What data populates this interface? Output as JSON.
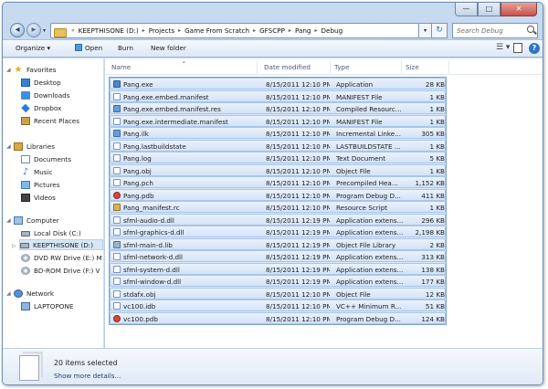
{
  "address": {
    "crumbs": [
      "KEEPTHISONE (D:)",
      "Projects",
      "Game From Scratch",
      "GFSCPP",
      "Pang",
      "Debug"
    ],
    "overflow_glyph": "«",
    "separator_glyph": "▸"
  },
  "search": {
    "placeholder": "Search Debug"
  },
  "window_controls": {
    "minimize": "—",
    "maximize": "□",
    "close": "✕"
  },
  "toolbar": {
    "organize_label": "Organize ▾",
    "open_label": "Open",
    "burn_label": "Burn",
    "new_folder_label": "New folder",
    "views_glyph": "☰ ▾",
    "help_glyph": "?"
  },
  "nav": {
    "favorites_label": "Favorites",
    "favorites": [
      "Desktop",
      "Downloads",
      "Dropbox",
      "Recent Places"
    ],
    "libraries_label": "Libraries",
    "libraries": [
      "Documents",
      "Music",
      "Pictures",
      "Videos"
    ],
    "computer_label": "Computer",
    "drives": [
      "Local Disk (C:)",
      "KEEPTHISONE (D:)",
      "DVD RW Drive (E:) M",
      "BD-ROM Drive (F:) V"
    ],
    "selected_drive": "KEEPTHISONE (D:)",
    "network_label": "Network",
    "network_items": [
      "LAPTOPONE"
    ]
  },
  "columns": {
    "name": "Name",
    "date": "Date modified",
    "type": "Type",
    "size": "Size"
  },
  "files": [
    {
      "name": "Pang.exe",
      "date": "8/15/2011 12:10 PM",
      "type": "Application",
      "size": "28 KB",
      "icon": "exe-icon"
    },
    {
      "name": "Pang.exe.embed.manifest",
      "date": "8/15/2011 12:10 PM",
      "type": "MANIFEST File",
      "size": "1 KB",
      "icon": "doc-icon"
    },
    {
      "name": "Pang.exe.embed.manifest.res",
      "date": "8/15/2011 12:10 PM",
      "type": "Compiled Resourc...",
      "size": "1 KB",
      "icon": "res-icon"
    },
    {
      "name": "Pang.exe.intermediate.manifest",
      "date": "8/15/2011 12:10 PM",
      "type": "MANIFEST File",
      "size": "1 KB",
      "icon": "doc-icon"
    },
    {
      "name": "Pang.ilk",
      "date": "8/15/2011 12:10 PM",
      "type": "Incremental Linke...",
      "size": "305 KB",
      "icon": "res-icon"
    },
    {
      "name": "Pang.lastbuildstate",
      "date": "8/15/2011 12:10 PM",
      "type": "LASTBUILDSTATE ...",
      "size": "1 KB",
      "icon": "doc-icon"
    },
    {
      "name": "Pang.log",
      "date": "8/15/2011 12:10 PM",
      "type": "Text Document",
      "size": "5 KB",
      "icon": "doc-icon"
    },
    {
      "name": "Pang.obj",
      "date": "8/15/2011 12:10 PM",
      "type": "Object File",
      "size": "1 KB",
      "icon": "doc-icon"
    },
    {
      "name": "Pang.pch",
      "date": "8/15/2011 12:10 PM",
      "type": "Precompiled Hea...",
      "size": "1,152 KB",
      "icon": "doc-icon"
    },
    {
      "name": "Pang.pdb",
      "date": "8/15/2011 12:10 PM",
      "type": "Program Debug D...",
      "size": "411 KB",
      "icon": "pdb-icon"
    },
    {
      "name": "Pang_manifest.rc",
      "date": "8/15/2011 12:10 PM",
      "type": "Resource Script",
      "size": "1 KB",
      "icon": "rc-icon"
    },
    {
      "name": "sfml-audio-d.dll",
      "date": "8/15/2011 12:19 PM",
      "type": "Application extens...",
      "size": "296 KB",
      "icon": "doc-icon"
    },
    {
      "name": "sfml-graphics-d.dll",
      "date": "8/15/2011 12:19 PM",
      "type": "Application extens...",
      "size": "2,198 KB",
      "icon": "doc-icon"
    },
    {
      "name": "sfml-main-d.lib",
      "date": "8/15/2011 12:19 PM",
      "type": "Object File Library",
      "size": "2 KB",
      "icon": "lib-icon"
    },
    {
      "name": "sfml-network-d.dll",
      "date": "8/15/2011 12:19 PM",
      "type": "Application extens...",
      "size": "313 KB",
      "icon": "doc-icon"
    },
    {
      "name": "sfml-system-d.dll",
      "date": "8/15/2011 12:19 PM",
      "type": "Application extens...",
      "size": "138 KB",
      "icon": "doc-icon"
    },
    {
      "name": "sfml-window-d.dll",
      "date": "8/15/2011 12:19 PM",
      "type": "Application extens...",
      "size": "177 KB",
      "icon": "doc-icon"
    },
    {
      "name": "stdafx.obj",
      "date": "8/15/2011 12:10 PM",
      "type": "Object File",
      "size": "12 KB",
      "icon": "doc-icon"
    },
    {
      "name": "vc100.idb",
      "date": "8/15/2011 12:10 PM",
      "type": "VC++ Minimum R...",
      "size": "51 KB",
      "icon": "doc-icon"
    },
    {
      "name": "vc100.pdb",
      "date": "8/15/2011 12:10 PM",
      "type": "Program Debug D...",
      "size": "124 KB",
      "icon": "pdb-icon"
    }
  ],
  "details": {
    "count_text": "20 items selected",
    "more_text": "Show more details..."
  }
}
